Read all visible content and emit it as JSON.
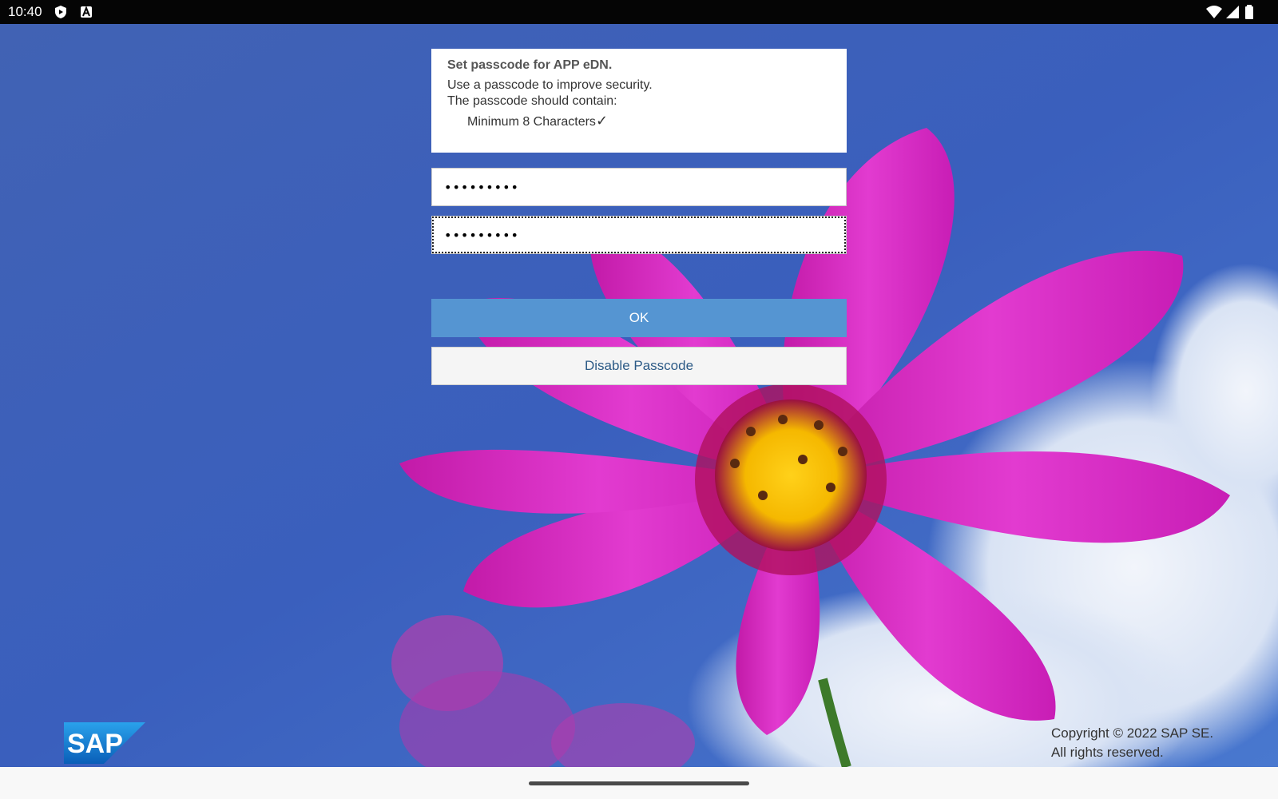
{
  "status_bar": {
    "time": "10:40",
    "left_icons": [
      "shield-play-icon",
      "font-a-icon"
    ],
    "right_icons": [
      "wifi-icon",
      "cell-signal-icon",
      "battery-icon"
    ]
  },
  "dialog": {
    "title": "Set passcode for APP eDN.",
    "line1": "Use a passcode to improve security.",
    "line2": "The passcode should contain:",
    "requirement": "Minimum 8 Characters",
    "requirement_check": "✓",
    "passcode_value": "•••••••••",
    "confirm_value": "•••••••••",
    "ok_label": "OK",
    "disable_label": "Disable Passcode"
  },
  "footer": {
    "logo_text": "SAP",
    "copyright_line1": "Copyright © 2022 SAP SE.",
    "copyright_line2": "All rights reserved."
  },
  "colors": {
    "ok_button": "#5595d2",
    "sky": "#3e63b8",
    "flower": "#d81fc0",
    "sap_blue": "#1a7ed6"
  }
}
